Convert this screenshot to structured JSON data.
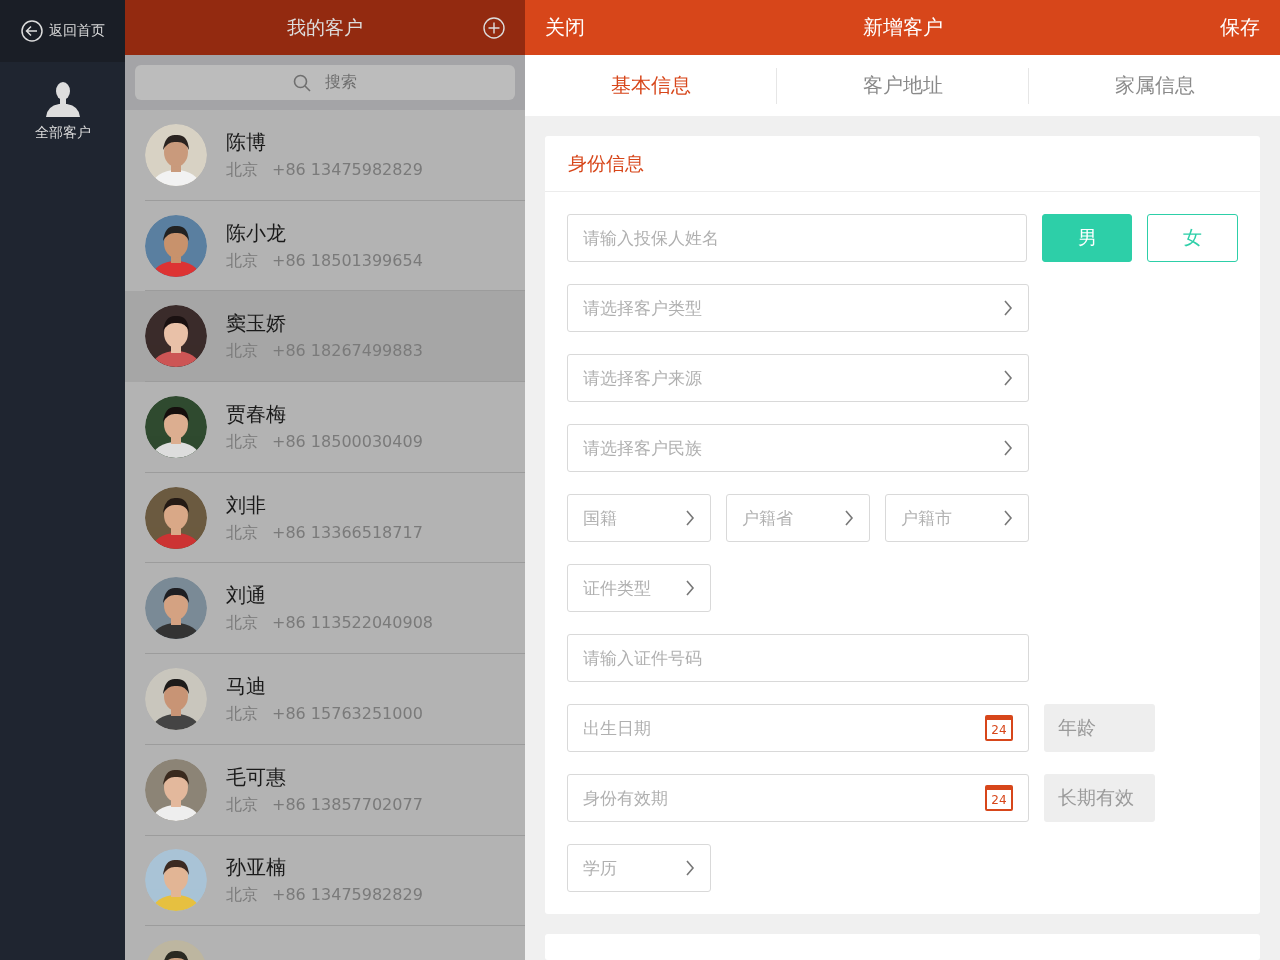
{
  "sidebar": {
    "back": "返回首页",
    "items": [
      {
        "label": "全部客户"
      }
    ]
  },
  "list": {
    "title": "我的客户",
    "search_placeholder": "搜索",
    "contacts": [
      {
        "name": "陈博",
        "city": "北京",
        "phone": "+86 13475982829",
        "selected": false
      },
      {
        "name": "陈小龙",
        "city": "北京",
        "phone": "+86 18501399654",
        "selected": false
      },
      {
        "name": "窦玉娇",
        "city": "北京",
        "phone": "+86 18267499883",
        "selected": true
      },
      {
        "name": "贾春梅",
        "city": "北京",
        "phone": "+86 18500030409",
        "selected": false
      },
      {
        "name": "刘非",
        "city": "北京",
        "phone": "+86 13366518717",
        "selected": false
      },
      {
        "name": "刘通",
        "city": "北京",
        "phone": "+86 113522040908",
        "selected": false
      },
      {
        "name": "马迪",
        "city": "北京",
        "phone": "+86 15763251000",
        "selected": false
      },
      {
        "name": "毛可惠",
        "city": "北京",
        "phone": "+86 13857702077",
        "selected": false
      },
      {
        "name": "孙亚楠",
        "city": "北京",
        "phone": "+86 13475982829",
        "selected": false
      },
      {
        "selected": false
      }
    ]
  },
  "editor": {
    "close": "关闭",
    "title": "新增客户",
    "save": "保存",
    "tabs": [
      {
        "label": "基本信息",
        "selected": true
      },
      {
        "label": "客户地址",
        "selected": false
      },
      {
        "label": "家属信息",
        "selected": false
      }
    ],
    "sections": [
      {
        "title": "身份信息",
        "rows": [
          {
            "fields": [
              {
                "kind": "input",
                "placeholder": "请输入投保人姓名"
              },
              {
                "kind": "toggle",
                "label": "男",
                "selected": true
              },
              {
                "kind": "toggle",
                "label": "女",
                "selected": false
              }
            ]
          },
          {
            "fields": [
              {
                "kind": "select",
                "placeholder": "请选择客户类型"
              }
            ]
          },
          {
            "fields": [
              {
                "kind": "select",
                "placeholder": "请选择客户来源"
              }
            ]
          },
          {
            "fields": [
              {
                "kind": "select",
                "placeholder": "请选择客户民族"
              }
            ]
          },
          {
            "fields": [
              {
                "kind": "picker",
                "placeholder": "国籍"
              },
              {
                "kind": "picker",
                "placeholder": "户籍省"
              },
              {
                "kind": "picker",
                "placeholder": "户籍市"
              }
            ]
          },
          {
            "fields": [
              {
                "kind": "picker",
                "placeholder": "证件类型"
              }
            ]
          },
          {
            "fields": [
              {
                "kind": "input",
                "placeholder": "请输入证件号码"
              }
            ]
          },
          {
            "fields": [
              {
                "kind": "date",
                "placeholder": "出生日期",
                "calendar_day": "24"
              },
              {
                "kind": "chip",
                "label": "年龄"
              }
            ]
          },
          {
            "fields": [
              {
                "kind": "date",
                "placeholder": "身份有效期",
                "calendar_day": "24"
              },
              {
                "kind": "chip",
                "label": "长期有效"
              }
            ]
          },
          {
            "fields": [
              {
                "kind": "picker",
                "placeholder": "学历"
              }
            ]
          }
        ]
      }
    ],
    "more_below": true
  }
}
